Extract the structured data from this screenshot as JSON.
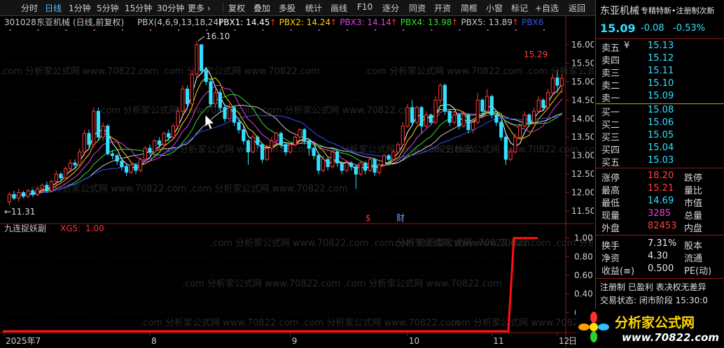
{
  "toolbar": {
    "items": [
      "分时",
      "日线",
      "1分钟",
      "5分钟",
      "15分钟",
      "30分钟",
      "更多 ›",
      "复权",
      "叠加",
      "多股",
      "统计",
      "画线",
      "F10",
      "逐分",
      "同资",
      "开资",
      "简框",
      "小窗",
      "标记",
      "+自选",
      "返回"
    ],
    "active": "日线"
  },
  "header": {
    "code": "301028",
    "name": "东亚机械",
    "mode": "(日线,前复权)",
    "pbx_label": "PBX(4,6,9,13,18,24)",
    "pbx": [
      {
        "label": "PBX1:",
        "value": "14.45",
        "arrow": "↑",
        "color": "#ffffff"
      },
      {
        "label": "PBX2:",
        "value": "14.24",
        "arrow": "↑",
        "color": "#ffd000"
      },
      {
        "label": "PBX3:",
        "value": "14.14",
        "arrow": "↑",
        "color": "#e040e0"
      },
      {
        "label": "PBX4:",
        "value": "13.98",
        "arrow": "↑",
        "color": "#30e030"
      },
      {
        "label": "PBX5:",
        "value": "13.89",
        "arrow": "↑",
        "color": "#c8c8c8"
      },
      {
        "label": "PBX6",
        "value": "",
        "arrow": "",
        "color": "#3050ff"
      }
    ]
  },
  "price_axis": {
    "ticks": [
      "16.00",
      "15.50",
      "15.00",
      "14.50",
      "14.00",
      "13.50",
      "13.00",
      "12.50",
      "12.00",
      "11.50"
    ]
  },
  "annotations": {
    "high": "16.10",
    "low": "←11.31",
    "last_high": "15.29",
    "marker1": "$",
    "marker2": "财"
  },
  "indicator": {
    "name": "九连捉妖副",
    "series": "XG5:",
    "value": "1.00",
    "ticks": [
      "1.00",
      "0.80",
      "0.60",
      "0.40",
      "0.20"
    ]
  },
  "time_axis": {
    "labels": [
      "2025年7",
      "8",
      "9",
      "10",
      "11",
      "12"
    ],
    "right_label": "日"
  },
  "watermark": ".com 分析家公式网 www.70822.com",
  "quote": {
    "name": "东亚机械",
    "scroll": "专精特新•注册制次新",
    "price": "15.09",
    "change": "-0.08",
    "pct": "-0.53%",
    "sell_mark": "¥",
    "asks": [
      {
        "label": "卖五",
        "price": "15.13"
      },
      {
        "label": "卖四",
        "price": "15.12"
      },
      {
        "label": "卖三",
        "price": "15.11"
      },
      {
        "label": "卖二",
        "price": "15.10"
      },
      {
        "label": "卖一",
        "price": "15.09"
      }
    ],
    "bids": [
      {
        "label": "买一",
        "price": "15.08"
      },
      {
        "label": "买二",
        "price": "15.06"
      },
      {
        "label": "买三",
        "price": "15.05"
      },
      {
        "label": "买四",
        "price": "15.04"
      },
      {
        "label": "买五",
        "price": "15.03"
      }
    ],
    "stats1": [
      {
        "label": "涨停",
        "value": "18.20",
        "color": "#ff4040",
        "label2": "跌停"
      },
      {
        "label": "最高",
        "value": "15.21",
        "color": "#ff4040",
        "label2": "量比"
      },
      {
        "label": "最低",
        "value": "14.69",
        "color": "#33e0ff",
        "label2": "市值"
      },
      {
        "label": "现量",
        "value": "3285",
        "color": "#e040e0",
        "label2": "总量"
      },
      {
        "label": "外盘",
        "value": "82453",
        "color": "#ff4040",
        "label2": "内盘"
      }
    ],
    "stats2": [
      {
        "label": "换手",
        "value": "7.31%",
        "color": "#e8e8e8",
        "label2": "股本"
      },
      {
        "label": "净资",
        "value": "4.30",
        "color": "#e8e8e8",
        "label2": "流通"
      },
      {
        "label": "收益(≡)",
        "value": "0.500",
        "color": "#e8e8e8",
        "label2": "PE(动)"
      }
    ],
    "footer1": "注册制 已盈利 表决权无差异",
    "footer2": "交易状态: 闭市阶段 15:30:0"
  },
  "logo": {
    "text": "分析家公式网",
    "url": "www.70822.com"
  },
  "colors": {
    "up": "#ff3c3c",
    "down": "#33e0ff",
    "panel_border": "#b02020",
    "signal": "#ff1010"
  },
  "chart_data": {
    "type": "candlestick",
    "ylim": [
      11.2,
      16.3
    ],
    "candles": [
      [
        11.75,
        11.95,
        11.65,
        12.0
      ],
      [
        11.95,
        11.85,
        11.8,
        12.05
      ],
      [
        11.85,
        12.0,
        11.75,
        12.1
      ],
      [
        12.0,
        11.9,
        11.85,
        12.05
      ],
      [
        11.9,
        12.05,
        11.85,
        12.1
      ],
      [
        12.05,
        11.95,
        11.88,
        12.1
      ],
      [
        11.95,
        12.1,
        11.9,
        12.15
      ],
      [
        12.1,
        12.2,
        12.0,
        12.25
      ],
      [
        12.2,
        12.05,
        12.0,
        12.3
      ],
      [
        12.05,
        12.3,
        12.0,
        12.35
      ],
      [
        12.3,
        12.5,
        12.2,
        12.6
      ],
      [
        12.5,
        12.4,
        12.3,
        12.55
      ],
      [
        12.4,
        12.65,
        12.35,
        12.7
      ],
      [
        12.65,
        12.8,
        12.55,
        12.9
      ],
      [
        12.8,
        12.75,
        12.65,
        12.9
      ],
      [
        12.75,
        13.1,
        12.7,
        13.2
      ],
      [
        13.1,
        13.6,
        13.0,
        13.7
      ],
      [
        13.6,
        13.3,
        13.2,
        13.7
      ],
      [
        13.3,
        14.2,
        13.25,
        14.3
      ],
      [
        14.2,
        13.5,
        13.4,
        14.3
      ],
      [
        13.5,
        13.8,
        13.4,
        13.9
      ],
      [
        13.8,
        13.05,
        13.0,
        13.85
      ],
      [
        13.05,
        13.0,
        12.9,
        13.15
      ],
      [
        13.0,
        12.85,
        12.75,
        13.05
      ],
      [
        12.85,
        12.7,
        12.6,
        12.9
      ],
      [
        12.7,
        12.55,
        12.45,
        12.75
      ],
      [
        12.55,
        12.75,
        12.5,
        12.8
      ],
      [
        12.75,
        12.6,
        12.5,
        12.8
      ],
      [
        12.6,
        12.9,
        12.55,
        12.95
      ],
      [
        12.9,
        13.2,
        12.85,
        13.25
      ],
      [
        13.2,
        13.1,
        13.0,
        13.3
      ],
      [
        13.1,
        13.4,
        13.05,
        13.45
      ],
      [
        13.4,
        13.3,
        13.2,
        13.5
      ],
      [
        13.3,
        13.6,
        13.25,
        13.65
      ],
      [
        13.6,
        13.5,
        13.4,
        13.7
      ],
      [
        13.5,
        13.8,
        13.45,
        13.85
      ],
      [
        13.8,
        14.2,
        13.7,
        14.3
      ],
      [
        14.2,
        14.8,
        14.1,
        14.9
      ],
      [
        14.8,
        14.4,
        14.3,
        14.9
      ],
      [
        14.4,
        15.2,
        14.35,
        15.3
      ],
      [
        15.2,
        16.0,
        15.1,
        16.1
      ],
      [
        16.0,
        15.3,
        15.2,
        16.0
      ],
      [
        15.3,
        15.0,
        14.9,
        15.4
      ],
      [
        15.0,
        14.4,
        14.3,
        15.1
      ],
      [
        14.4,
        14.7,
        14.3,
        14.8
      ],
      [
        14.7,
        14.3,
        14.2,
        14.8
      ],
      [
        14.3,
        14.0,
        13.9,
        14.4
      ],
      [
        14.0,
        14.3,
        13.95,
        14.4
      ],
      [
        14.3,
        13.9,
        13.8,
        14.35
      ],
      [
        13.9,
        13.7,
        13.6,
        14.0
      ],
      [
        13.7,
        13.4,
        13.3,
        13.8
      ],
      [
        13.4,
        13.1,
        12.75,
        13.45
      ],
      [
        13.1,
        13.5,
        13.05,
        13.6
      ],
      [
        13.5,
        13.3,
        13.2,
        13.55
      ],
      [
        13.3,
        12.9,
        12.8,
        13.35
      ],
      [
        12.9,
        13.2,
        12.85,
        13.3
      ],
      [
        13.2,
        13.4,
        13.1,
        13.5
      ],
      [
        13.4,
        13.6,
        13.35,
        13.65
      ],
      [
        13.6,
        13.3,
        13.2,
        13.65
      ],
      [
        13.3,
        13.1,
        13.0,
        13.35
      ],
      [
        13.1,
        13.3,
        13.05,
        13.35
      ],
      [
        13.3,
        13.5,
        13.25,
        13.55
      ],
      [
        13.5,
        13.7,
        13.4,
        13.75
      ],
      [
        13.7,
        13.4,
        13.3,
        13.75
      ],
      [
        13.4,
        13.2,
        13.0,
        13.45
      ],
      [
        13.2,
        13.0,
        12.9,
        13.25
      ],
      [
        13.0,
        12.6,
        12.5,
        13.05
      ],
      [
        12.6,
        12.9,
        12.55,
        13.0
      ],
      [
        12.9,
        12.7,
        12.6,
        12.95
      ],
      [
        12.7,
        13.1,
        12.65,
        13.15
      ],
      [
        13.1,
        12.8,
        12.7,
        13.15
      ],
      [
        12.8,
        12.6,
        12.5,
        12.85
      ],
      [
        12.6,
        12.8,
        12.55,
        12.85
      ],
      [
        12.8,
        12.7,
        12.6,
        12.85
      ],
      [
        12.7,
        12.5,
        12.1,
        12.75
      ],
      [
        12.5,
        12.8,
        12.45,
        12.85
      ],
      [
        12.8,
        12.6,
        12.5,
        12.85
      ],
      [
        12.6,
        12.9,
        12.55,
        12.95
      ],
      [
        12.9,
        12.55,
        12.45,
        12.95
      ],
      [
        12.55,
        12.75,
        12.5,
        12.8
      ],
      [
        12.75,
        13.0,
        12.7,
        13.05
      ],
      [
        13.0,
        12.9,
        12.8,
        13.05
      ],
      [
        12.9,
        13.1,
        12.85,
        13.15
      ],
      [
        13.1,
        13.3,
        13.05,
        13.35
      ],
      [
        13.3,
        13.8,
        13.25,
        13.9
      ],
      [
        13.8,
        14.3,
        13.75,
        14.4
      ],
      [
        14.3,
        13.9,
        13.8,
        14.5
      ],
      [
        13.9,
        14.3,
        13.85,
        14.35
      ],
      [
        14.3,
        13.8,
        13.6,
        14.35
      ],
      [
        13.8,
        14.1,
        13.75,
        14.2
      ],
      [
        14.1,
        13.9,
        13.85,
        14.15
      ],
      [
        13.9,
        14.5,
        13.85,
        14.6
      ],
      [
        14.5,
        14.9,
        14.4,
        14.95
      ],
      [
        14.9,
        14.2,
        14.1,
        14.95
      ],
      [
        14.2,
        13.9,
        13.8,
        14.25
      ],
      [
        13.9,
        14.1,
        13.85,
        14.2
      ],
      [
        14.1,
        13.8,
        13.7,
        14.15
      ],
      [
        13.8,
        14.1,
        13.75,
        14.2
      ],
      [
        14.1,
        13.7,
        13.6,
        14.15
      ],
      [
        13.7,
        13.9,
        13.6,
        14.0
      ],
      [
        13.9,
        14.5,
        13.85,
        14.7
      ],
      [
        14.5,
        14.2,
        14.1,
        14.55
      ],
      [
        14.2,
        14.6,
        14.15,
        14.8
      ],
      [
        14.6,
        14.1,
        14.0,
        14.65
      ],
      [
        14.1,
        13.9,
        13.8,
        14.15
      ],
      [
        13.9,
        13.5,
        13.4,
        13.95
      ],
      [
        13.5,
        12.9,
        12.75,
        13.55
      ],
      [
        12.9,
        13.1,
        12.85,
        13.2
      ],
      [
        13.1,
        13.5,
        13.05,
        13.6
      ],
      [
        13.5,
        13.8,
        13.45,
        13.9
      ],
      [
        13.8,
        14.1,
        13.75,
        14.2
      ],
      [
        14.1,
        13.9,
        13.8,
        14.15
      ],
      [
        13.9,
        14.2,
        13.85,
        14.3
      ],
      [
        14.2,
        14.5,
        14.15,
        14.6
      ],
      [
        14.5,
        14.3,
        14.2,
        14.55
      ],
      [
        14.3,
        14.7,
        14.25,
        14.8
      ],
      [
        14.7,
        15.1,
        14.65,
        15.21
      ],
      [
        15.1,
        14.9,
        14.7,
        15.29
      ],
      [
        14.9,
        15.09,
        14.69,
        15.21
      ]
    ],
    "signal": {
      "name": "XG5",
      "ylim": [
        0,
        1.05
      ],
      "switch_fraction": 0.955,
      "values_after": 1.0,
      "values_before": 0.0
    },
    "ma_colors": [
      "#ffffff",
      "#ffd000",
      "#e040e0",
      "#30e030",
      "#c8c8c8",
      "#3050ff"
    ],
    "ma_periods": [
      4,
      6,
      9,
      13,
      18,
      24
    ],
    "x_label_index": [
      0,
      30,
      60,
      85,
      103,
      117
    ]
  }
}
